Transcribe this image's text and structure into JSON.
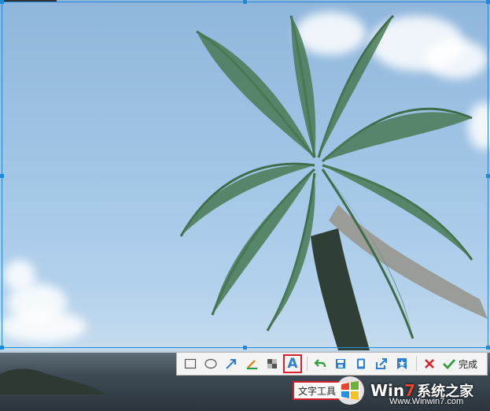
{
  "toolbar": {
    "tools": [
      {
        "name": "rectangle-icon"
      },
      {
        "name": "ellipse-icon"
      },
      {
        "name": "arrow-icon"
      },
      {
        "name": "pen-icon"
      },
      {
        "name": "mosaic-icon"
      },
      {
        "name": "text-tool-icon",
        "glyph": "A",
        "active": true
      },
      {
        "name": "undo-icon"
      },
      {
        "name": "save-icon"
      },
      {
        "name": "copy-icon"
      },
      {
        "name": "share-icon"
      },
      {
        "name": "pin-icon"
      },
      {
        "name": "cancel-icon"
      }
    ],
    "done_label": "完成"
  },
  "tooltip": {
    "label": "文字工具"
  },
  "watermark": {
    "brand_w": "Win",
    "brand_7": "7",
    "brand_cn": "系统之家",
    "url": "Www.Winwin7.com"
  },
  "colors": {
    "selection": "#1f8ad8",
    "highlight": "#d9202a",
    "accent_blue": "#2a7fd4",
    "accent_green": "#2e9b3d"
  }
}
